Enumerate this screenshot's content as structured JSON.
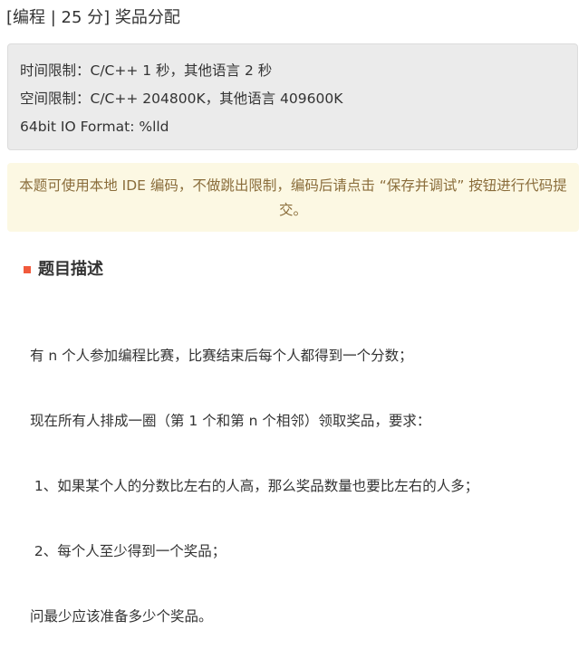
{
  "problem": {
    "title": "[编程 | 25 分] 奖品分配"
  },
  "limits": {
    "time": "时间限制：C/C++ 1 秒，其他语言 2 秒",
    "space": "空间限制：C/C++ 204800K，其他语言 409600K",
    "io_format": "64bit IO Format: %lld"
  },
  "notice": {
    "text": "本题可使用本地 IDE 编码，不做跳出限制，编码后请点击 “保存并调试” 按钮进行代码提交。"
  },
  "description": {
    "heading": "题目描述",
    "lines": [
      "有 n 个人参加编程比赛，比赛结束后每个人都得到一个分数；",
      "现在所有人排成一圈（第 1 个和第 n 个相邻）领取奖品，要求：",
      " 1、如果某个人的分数比左右的人高，那么奖品数量也要比左右的人多；",
      " 2、每个人至少得到一个奖品；",
      "问最少应该准备多少个奖品。"
    ]
  },
  "colors": {
    "accent_marker": "#f15a3c",
    "limits_background": "#ebebeb",
    "notice_background": "#fcf8e3",
    "notice_text": "#8a6d3b"
  }
}
